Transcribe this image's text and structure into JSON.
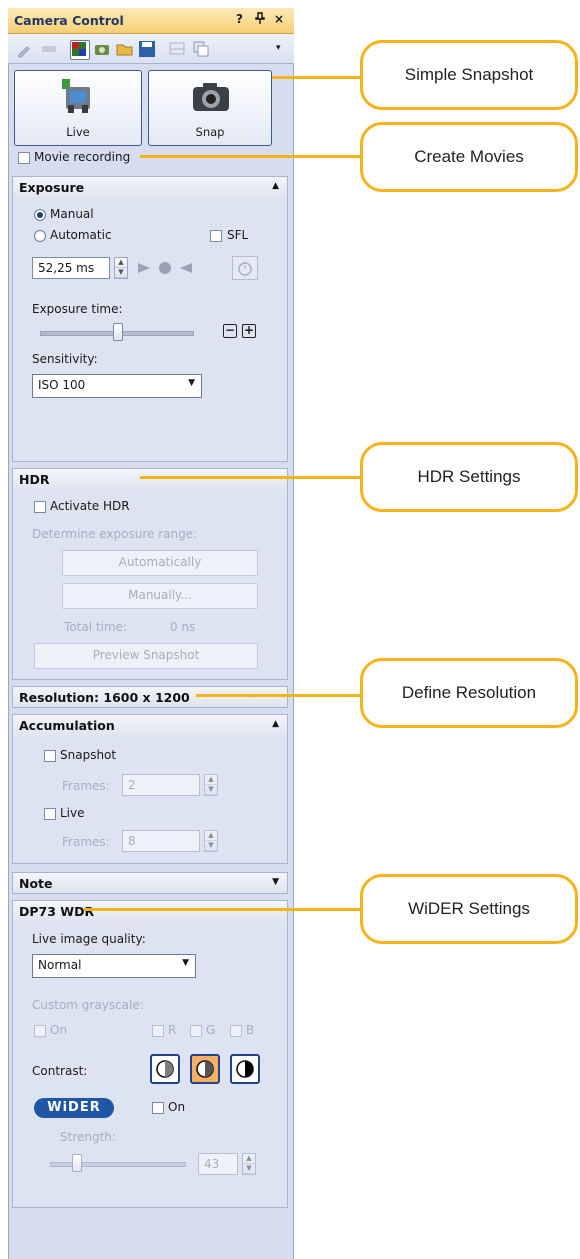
{
  "window": {
    "title": "Camera Control",
    "controls": [
      "?",
      "¤",
      "×"
    ]
  },
  "toolbar": {
    "icons": [
      "pipette-icon",
      "hide-icon",
      "color-palette-icon",
      "camera-settings-icon",
      "open-folder-icon",
      "save-icon",
      "compare-icon",
      "copy-icon"
    ],
    "overflow": "☰"
  },
  "buttons": {
    "live": "Live",
    "snap": "Snap"
  },
  "movie_recording": "Movie recording",
  "exposure": {
    "title": "Exposure",
    "manual": "Manual",
    "automatic": "Automatic",
    "sfl": "SFL",
    "value": "52,25 ms",
    "exposure_time_label": "Exposure time:",
    "sensitivity_label": "Sensitivity:",
    "sensitivity_value": "ISO 100"
  },
  "hdr": {
    "title": "HDR",
    "activate": "Activate HDR",
    "determine": "Determine exposure range:",
    "automatically": "Automatically",
    "manually": "Manually...",
    "total_time_label": "Total time:",
    "total_time_value": "0 ns",
    "preview": "Preview Snapshot"
  },
  "resolution": {
    "title": "Resolution: 1600 x 1200"
  },
  "accumulation": {
    "title": "Accumulation",
    "snapshot": "Snapshot",
    "frames_label": "Frames:",
    "snapshot_frames": "2",
    "live": "Live",
    "live_frames": "8"
  },
  "note": {
    "title": "Note"
  },
  "wdr": {
    "title": "DP73 WDR",
    "quality_label": "Live image quality:",
    "quality_value": "Normal",
    "custom_grayscale": "Custom grayscale:",
    "on": "On",
    "r": "R",
    "g": "G",
    "b": "B",
    "contrast_label": "Contrast:",
    "wider_logo": "WiDER",
    "wider_on": "On",
    "strength_label": "Strength:",
    "strength_value": "43"
  },
  "callouts": {
    "simple_snapshot": "Simple Snapshot",
    "create_movies": "Create Movies",
    "hdr_settings": "HDR Settings",
    "define_resolution": "Define Resolution",
    "wider_settings": "WiDER Settings"
  },
  "colors": {
    "callout": "#f4b31a",
    "panel": "#d6ddee",
    "title_bar": "#f6cf74",
    "accent": "#233766"
  }
}
